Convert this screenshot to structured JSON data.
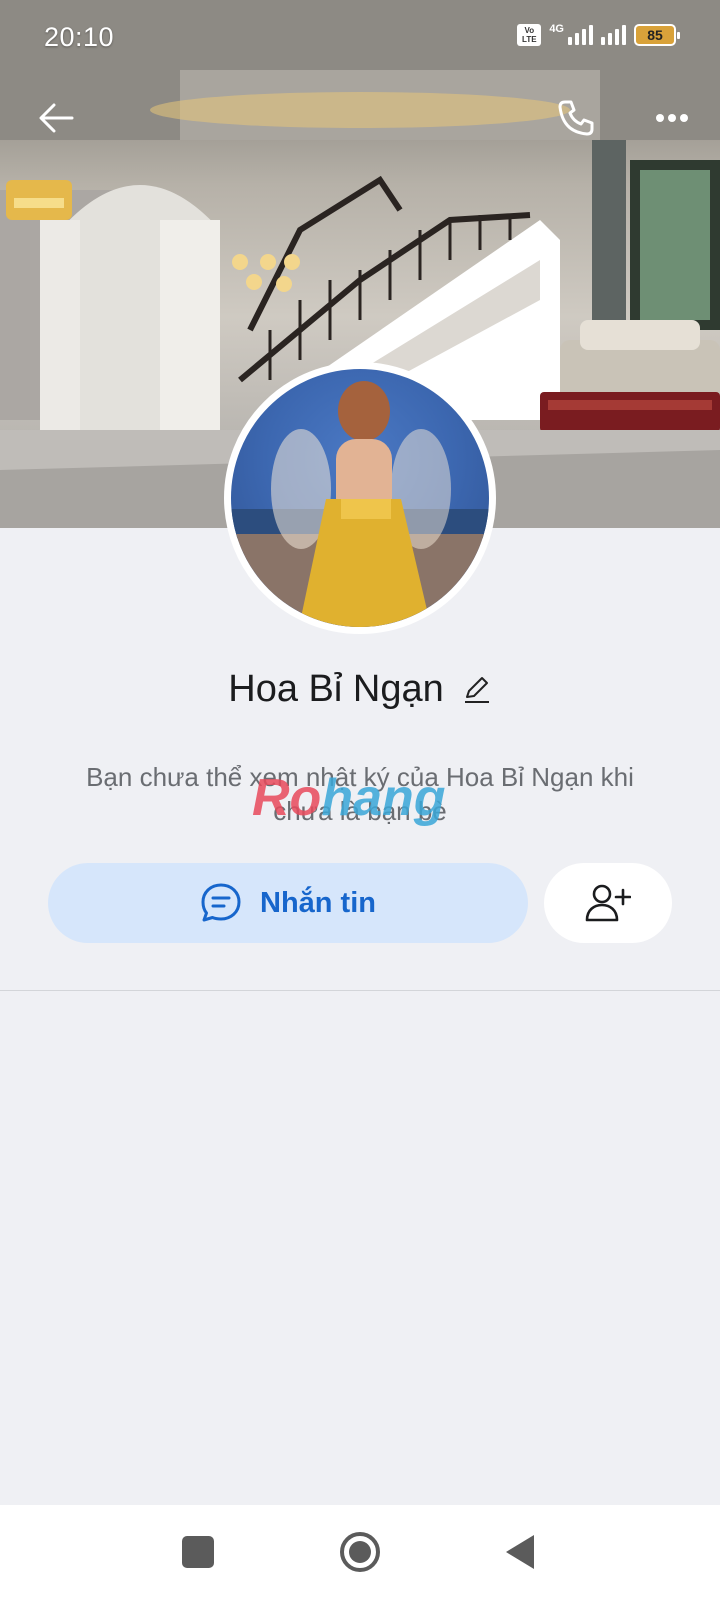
{
  "status_bar": {
    "time": "20:10",
    "volte": "Vo LTE",
    "network": "4G",
    "battery": "85"
  },
  "header": {
    "back_icon": "arrow-left-icon",
    "call_icon": "phone-icon",
    "more_icon": "more-horizontal-icon"
  },
  "profile": {
    "name": "Hoa Bỉ Ngạn",
    "edit_icon": "pencil-icon",
    "info_text": "Bạn chưa thể xem nhật ký của Hoa Bỉ Ngạn khi chưa là bạn bè"
  },
  "watermark": {
    "part1": "Ro",
    "part2": "hang"
  },
  "actions": {
    "message_label": "Nhắn tin",
    "message_icon": "chat-bubble-icon",
    "add_friend_icon": "add-user-icon"
  },
  "colors": {
    "accent": "#1766cc",
    "message_bg": "#d6e6fb",
    "page_bg": "#eff0f4"
  },
  "nav_bar": {
    "recents_icon": "square-icon",
    "home_icon": "circle-home-icon",
    "back_icon": "triangle-back-icon"
  }
}
